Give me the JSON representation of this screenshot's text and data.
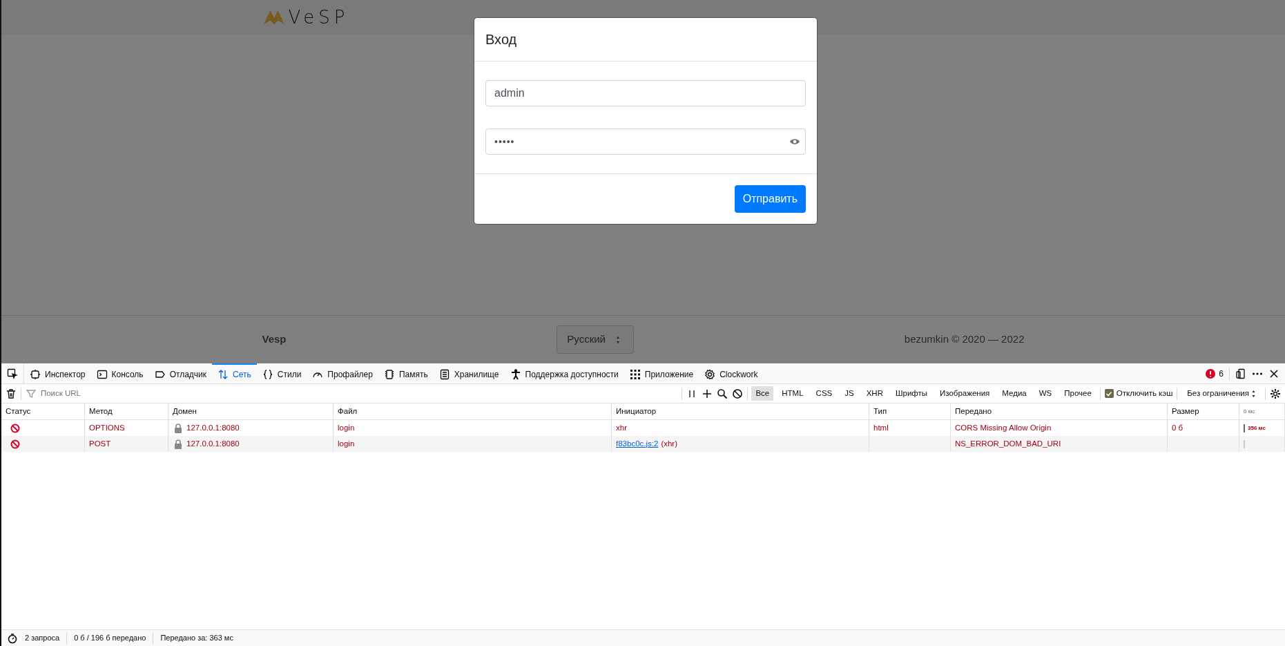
{
  "header": {
    "logo": "VeSP"
  },
  "modal": {
    "title": "Вход",
    "fields": [
      {
        "kind": "text",
        "value": "admin"
      },
      {
        "kind": "password",
        "value": "•••••"
      }
    ],
    "submit": "Отправить"
  },
  "footer": {
    "brand": "Vesp",
    "language": "Русский",
    "copyright": "bezumkin © 2020 — 2022"
  },
  "devtools": {
    "tabs": [
      {
        "label": "Инспектор",
        "selected": false
      },
      {
        "label": "Консоль",
        "selected": false
      },
      {
        "label": "Отладчик",
        "selected": false
      },
      {
        "label": "Сеть",
        "selected": true
      },
      {
        "label": "Стили",
        "selected": false
      },
      {
        "label": "Профайлер",
        "selected": false
      },
      {
        "label": "Память",
        "selected": false
      },
      {
        "label": "Хранилище",
        "selected": false
      },
      {
        "label": "Поддержка доступности",
        "selected": false
      },
      {
        "label": "Приложение",
        "selected": false
      },
      {
        "label": "Clockwork",
        "selected": false
      }
    ],
    "error_count": "6",
    "filter": {
      "placeholder": "Поиск URL"
    },
    "type_filters": [
      {
        "label": "Все",
        "selected": true
      },
      {
        "label": "HTML",
        "selected": false
      },
      {
        "label": "CSS",
        "selected": false
      },
      {
        "label": "JS",
        "selected": false
      },
      {
        "label": "XHR",
        "selected": false
      },
      {
        "label": "Шрифты",
        "selected": false
      },
      {
        "label": "Изображения",
        "selected": false
      },
      {
        "label": "Медиа",
        "selected": false
      },
      {
        "label": "WS",
        "selected": false
      },
      {
        "label": "Прочее",
        "selected": false
      }
    ],
    "disable_cache": {
      "label": "Отключить кэш",
      "checked": true
    },
    "throttling": "Без ограничения",
    "table": {
      "columns": [
        "Статус",
        "Метод",
        "Домен",
        "Файл",
        "Инициатор",
        "Тип",
        "Передано",
        "Размер",
        "0 мс"
      ],
      "rows": [
        {
          "method": "OPTIONS",
          "domain": "127.0.0.1:8080",
          "file": "login",
          "initiator": {
            "text": "xhr"
          },
          "type": "html",
          "transferred": "CORS Missing Allow Origin",
          "size": "0 б",
          "duration": "356 мс"
        },
        {
          "method": "POST",
          "domain": "127.0.0.1:8080",
          "file": "login",
          "initiator": {
            "link": "f83bc0c.js:2",
            "text": "(xhr)"
          },
          "transferred": "NS_ERROR_DOM_BAD_URI"
        }
      ]
    },
    "status_bar": [
      "2 запроса",
      "0 б / 196 б передано",
      "Передано за: 363 мс"
    ]
  }
}
